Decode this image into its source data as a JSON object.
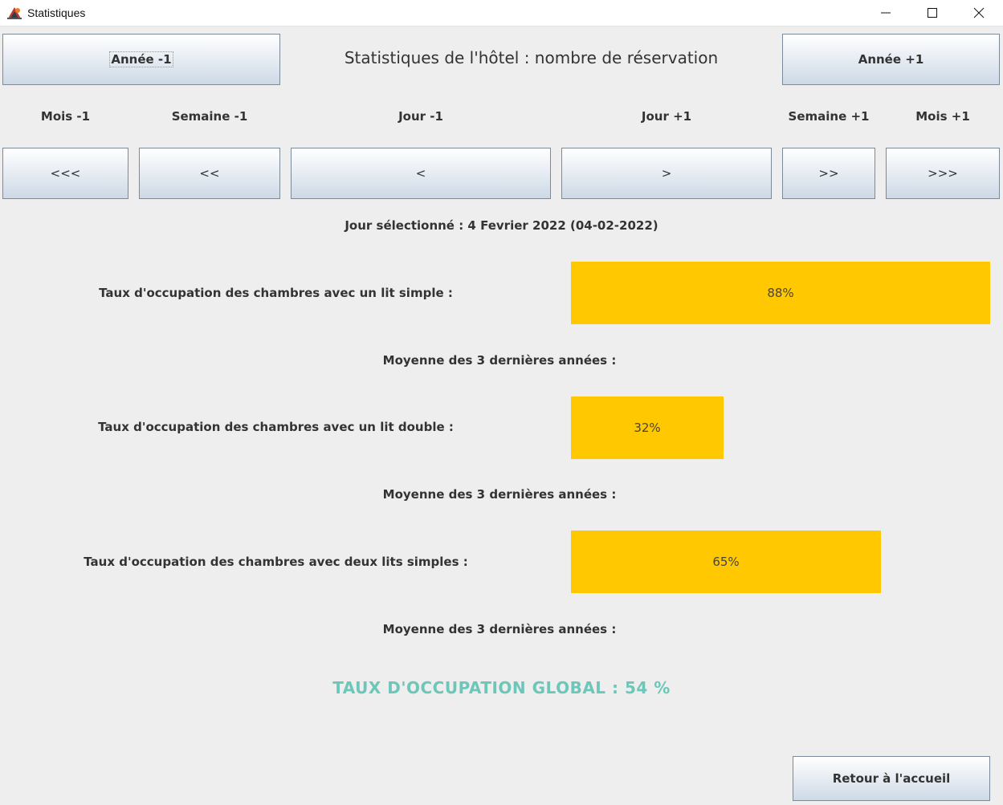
{
  "window": {
    "title": "Statistiques",
    "icon": "java-app-icon"
  },
  "header": {
    "prev_year_label": "Année -1",
    "next_year_label": "Année +1",
    "title": "Statistiques de l'hôtel : nombre de réservation"
  },
  "nav": {
    "captions": {
      "month_prev": "Mois -1",
      "week_prev": "Semaine -1",
      "day_prev": "Jour -1",
      "day_next": "Jour +1",
      "week_next": "Semaine +1",
      "month_next": "Mois +1"
    },
    "buttons": {
      "month_prev": "<<<",
      "week_prev": "<<",
      "day_prev": "<",
      "day_next": ">",
      "week_next": ">>",
      "month_next": ">>>"
    }
  },
  "selected_day": "Jour sélectionné : 4 Fevrier 2022 (04-02-2022)",
  "occupancy": [
    {
      "label": "Taux d'occupation des chambres avec un lit simple :",
      "value_text": "88%",
      "value": 88,
      "average_label": "Moyenne des 3 dernières années :"
    },
    {
      "label": "Taux d'occupation des chambres avec un lit double :",
      "value_text": "32%",
      "value": 32,
      "average_label": "Moyenne des 3 dernières années :"
    },
    {
      "label": "Taux d'occupation des chambres avec deux lits simples :",
      "value_text": "65%",
      "value": 65,
      "average_label": "Moyenne des 3 dernières années :"
    }
  ],
  "global_rate": "TAUX D'OCCUPATION GLOBAL : 54 %",
  "footer": {
    "back_label": "Retour à l'accueil"
  },
  "colors": {
    "bar": "#ffc800",
    "global_text": "#6dc7b9"
  }
}
